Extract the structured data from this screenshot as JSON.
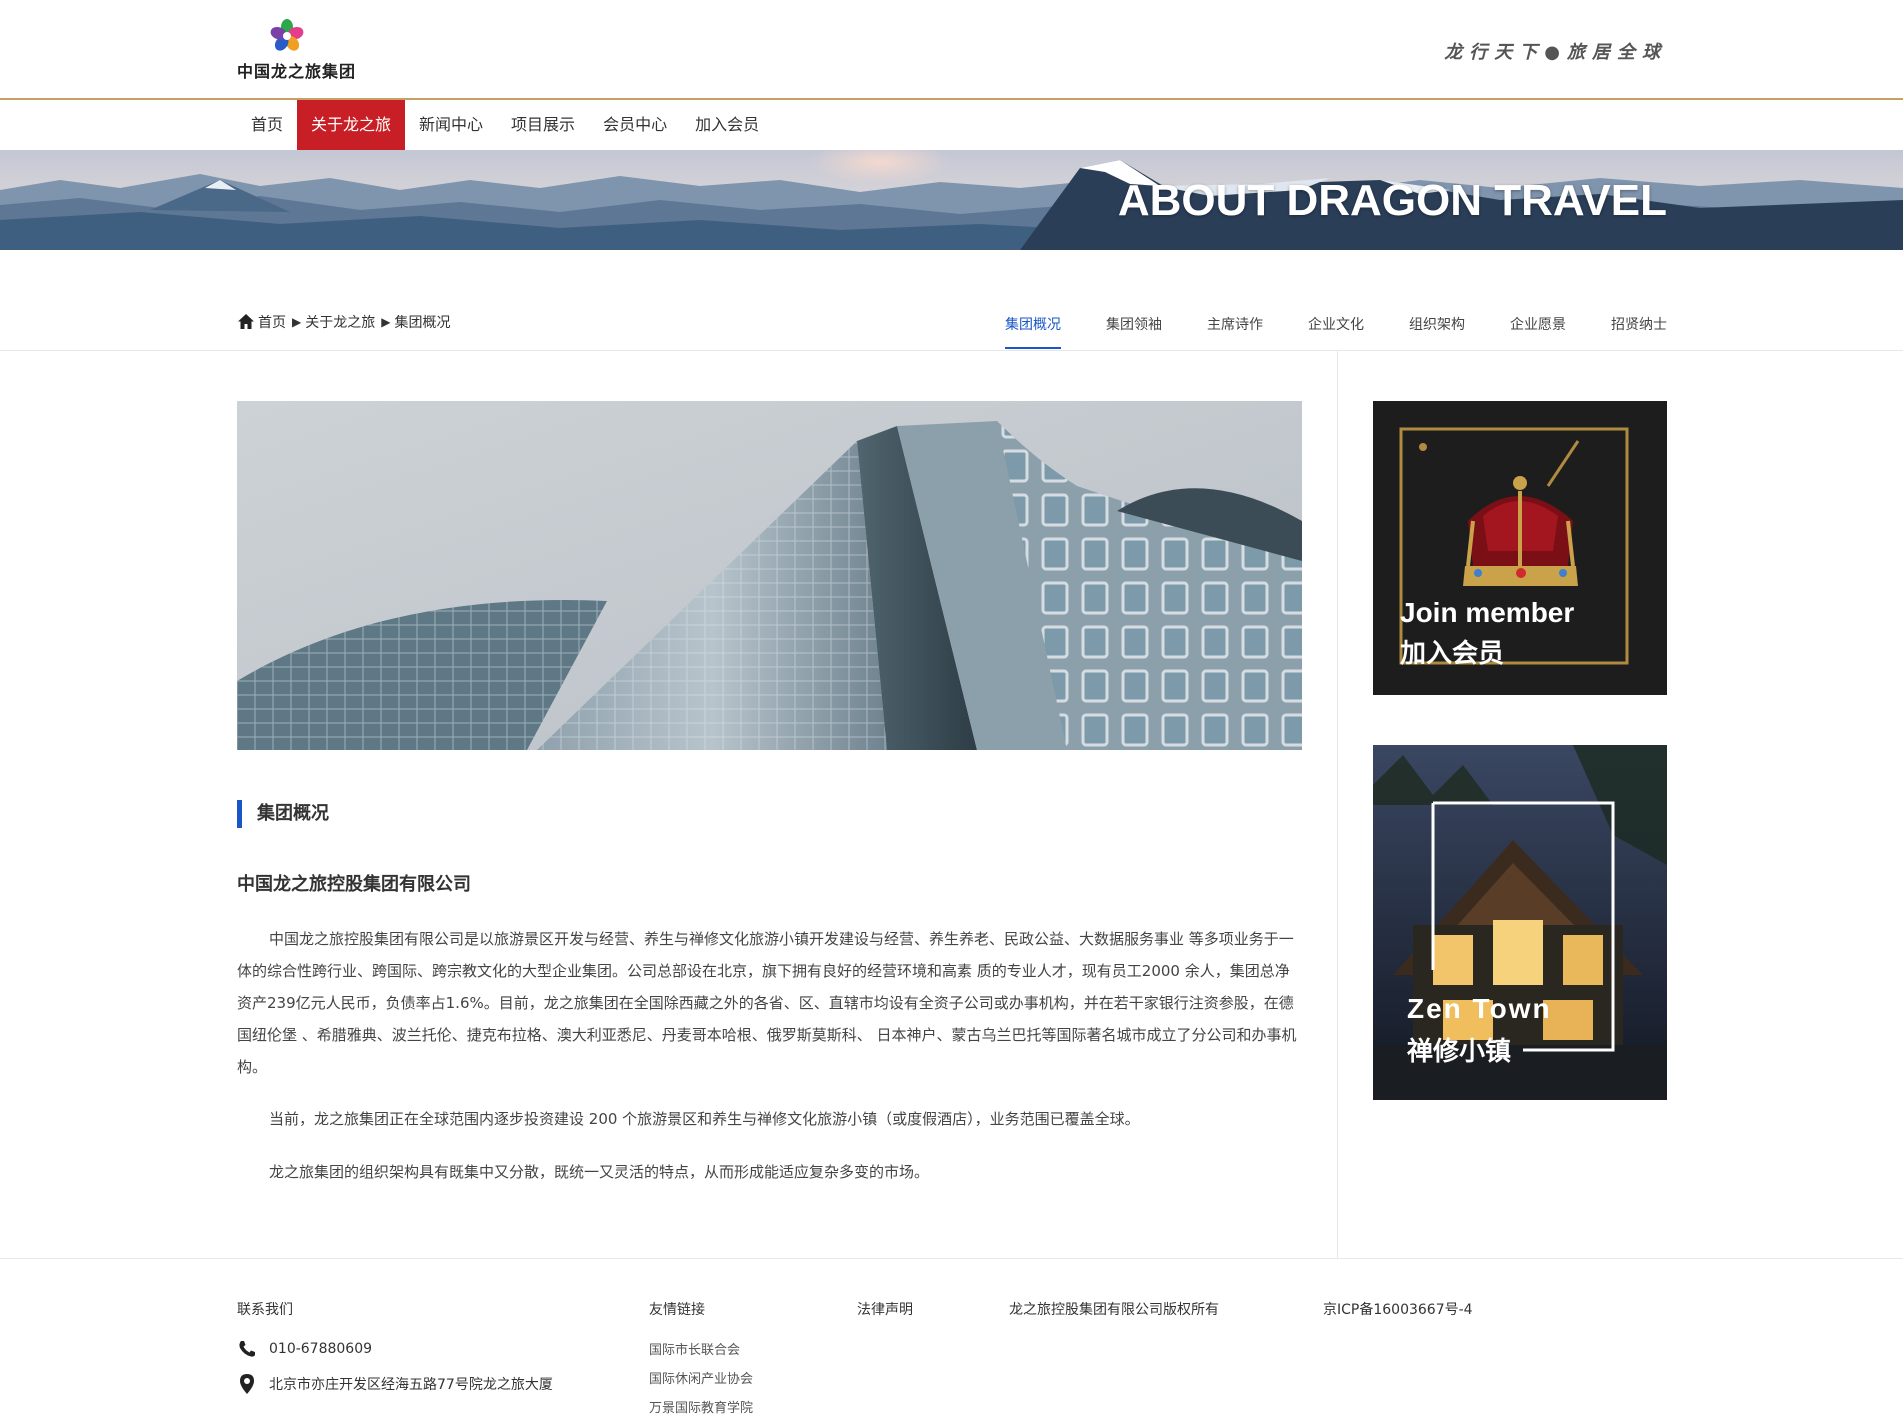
{
  "header": {
    "logo_text": "中国龙之旅集团",
    "slogan": "龙行天下●旅居全球"
  },
  "nav": {
    "items": [
      "首页",
      "关于龙之旅",
      "新闻中心",
      "项目展示",
      "会员中心",
      "加入会员"
    ],
    "active_index": 1
  },
  "banner": {
    "title": "ABOUT DRAGON TRAVEL"
  },
  "breadcrumb": {
    "home": "首页",
    "level1": "关于龙之旅",
    "level2": "集团概况",
    "separator": "▶"
  },
  "subtabs": {
    "items": [
      "集团概况",
      "集团领袖",
      "主席诗作",
      "企业文化",
      "组织架构",
      "企业愿景",
      "招贤纳士"
    ],
    "active_index": 0
  },
  "content": {
    "section_title": "集团概况",
    "company_name": "中国龙之旅控股集团有限公司",
    "paragraphs": [
      "中国龙之旅控股集团有限公司是以旅游景区开发与经营、养生与禅修文化旅游小镇开发建设与经营、养生养老、民政公益、大数据服务事业 等多项业务于一体的综合性跨行业、跨国际、跨宗教文化的大型企业集团。公司总部设在北京，旗下拥有良好的经营环境和高素 质的专业人才，现有员工2000 余人，集团总净资产239亿元人民币，负债率占1.6%。目前，龙之旅集团在全国除西藏之外的各省、区、直辖市均设有全资子公司或办事机构，并在若干家银行注资参股，在德国纽伦堡 、希腊雅典、波兰托伦、捷克布拉格、澳大利亚悉尼、丹麦哥本哈根、俄罗斯莫斯科、 日本神户、蒙古乌兰巴托等国际著名城市成立了分公司和办事机构。",
      "当前，龙之旅集团正在全球范围内逐步投资建设 200 个旅游景区和养生与禅修文化旅游小镇（或度假酒店），业务范围已覆盖全球。",
      "龙之旅集团的组织架构具有既集中又分散，既统一又灵活的特点，从而形成能适应复杂多变的市场。"
    ]
  },
  "sidebar": {
    "card1": {
      "title_en": "Join member",
      "title_zh": "加入会员"
    },
    "card2": {
      "title_en": "Zen Town",
      "title_zh": "禅修小镇"
    }
  },
  "footer": {
    "contact_title": "联系我们",
    "phone": "010-67880609",
    "address": "北京市亦庄开发区经海五路77号院龙之旅大厦",
    "links_title": "友情链接",
    "links": [
      "国际市长联合会",
      "国际休闲产业协会",
      "万景国际教育学院"
    ],
    "legal": "法律声明",
    "copyright": "龙之旅控股集团有限公司版权所有",
    "icp": "京ICP备16003667号-4"
  },
  "colors": {
    "nav_active": "#c81e25",
    "tab_active": "#1a56c8",
    "header_rule": "#c8a064"
  }
}
